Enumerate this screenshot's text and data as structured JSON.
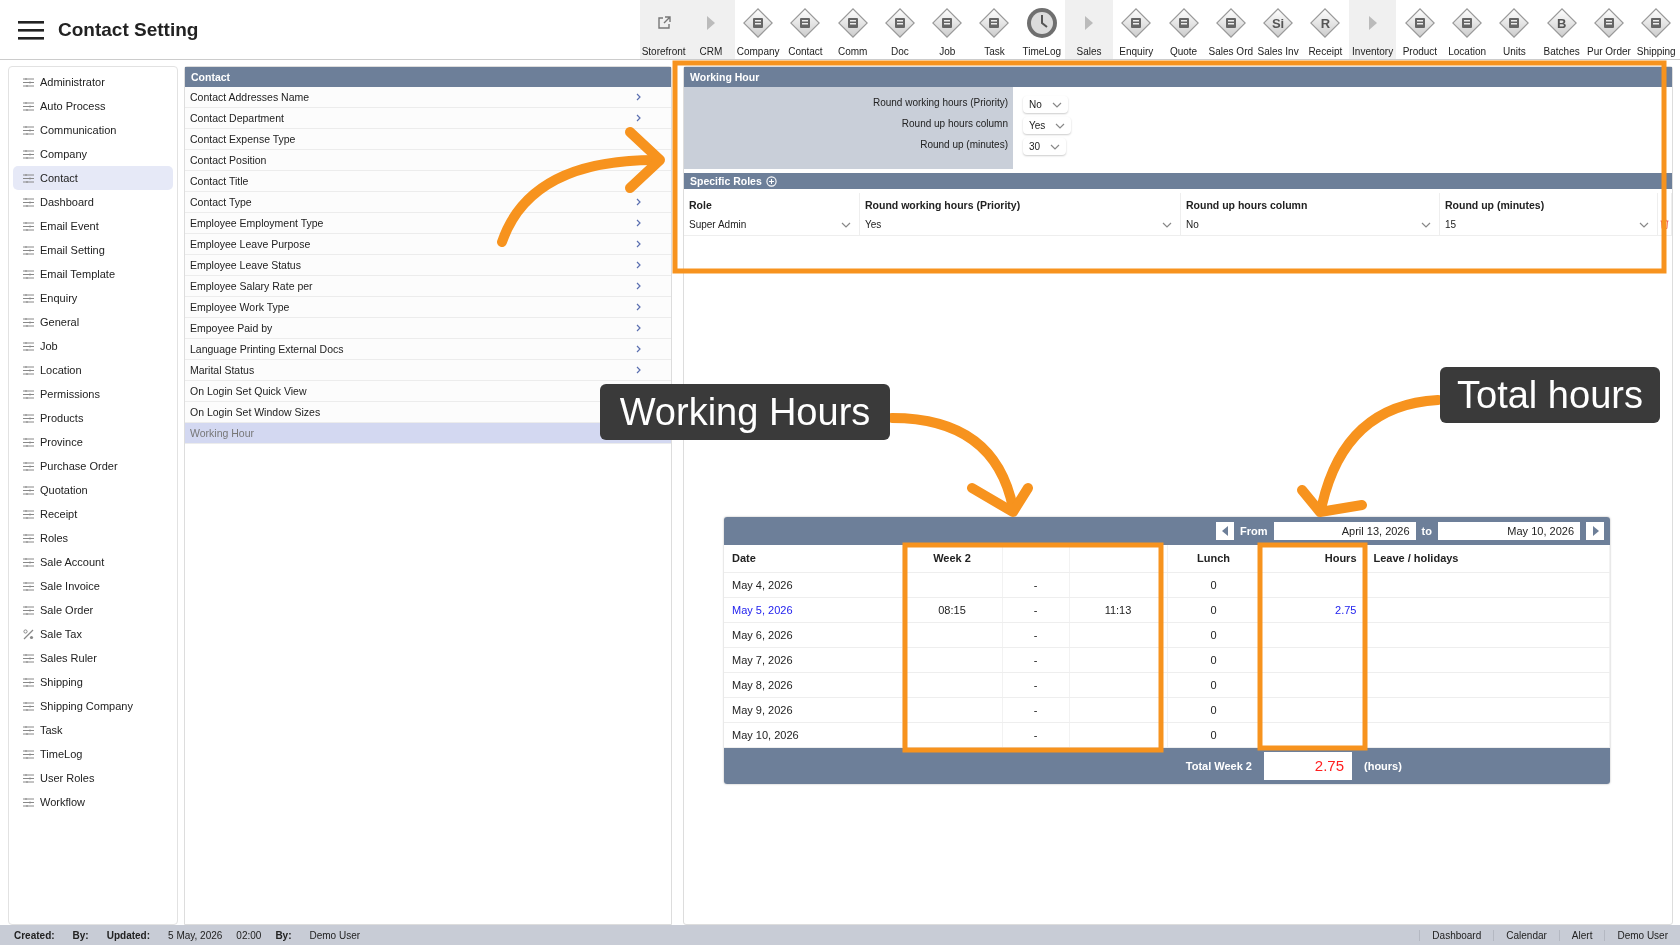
{
  "header": {
    "title": "Contact Setting"
  },
  "toolbar": [
    {
      "label": "Storefront",
      "kind": "link"
    },
    {
      "label": "CRM",
      "kind": "expander"
    },
    {
      "label": "Company",
      "kind": "module"
    },
    {
      "label": "Contact",
      "kind": "module"
    },
    {
      "label": "Comm",
      "kind": "module"
    },
    {
      "label": "Doc",
      "kind": "module"
    },
    {
      "label": "Job",
      "kind": "module"
    },
    {
      "label": "Task",
      "kind": "module"
    },
    {
      "label": "TimeLog",
      "kind": "clock"
    },
    {
      "label": "Sales",
      "kind": "expander"
    },
    {
      "label": "Enquiry",
      "kind": "module"
    },
    {
      "label": "Quote",
      "kind": "module"
    },
    {
      "label": "Sales Ord",
      "kind": "module"
    },
    {
      "label": "Sales Inv",
      "kind": "module",
      "glyph": "Si"
    },
    {
      "label": "Receipt",
      "kind": "module",
      "glyph": "R"
    },
    {
      "label": "Inventory",
      "kind": "expander"
    },
    {
      "label": "Product",
      "kind": "module"
    },
    {
      "label": "Location",
      "kind": "module"
    },
    {
      "label": "Units",
      "kind": "module"
    },
    {
      "label": "Batches",
      "kind": "module",
      "glyph": "B"
    },
    {
      "label": "Pur Order",
      "kind": "module"
    },
    {
      "label": "Shipping",
      "kind": "module"
    }
  ],
  "sidebar": {
    "items": [
      {
        "label": "Administrator",
        "kind": "list",
        "selected": false
      },
      {
        "label": "Auto Process",
        "kind": "list",
        "selected": false
      },
      {
        "label": "Communication",
        "kind": "list",
        "selected": false
      },
      {
        "label": "Company",
        "kind": "list",
        "selected": false
      },
      {
        "label": "Contact",
        "kind": "list",
        "selected": true
      },
      {
        "label": "Dashboard",
        "kind": "list",
        "selected": false
      },
      {
        "label": "Email Event",
        "kind": "list",
        "selected": false
      },
      {
        "label": "Email Setting",
        "kind": "list",
        "selected": false
      },
      {
        "label": "Email Template",
        "kind": "list",
        "selected": false
      },
      {
        "label": "Enquiry",
        "kind": "list",
        "selected": false
      },
      {
        "label": "General",
        "kind": "list",
        "selected": false
      },
      {
        "label": "Job",
        "kind": "list",
        "selected": false
      },
      {
        "label": "Location",
        "kind": "list",
        "selected": false
      },
      {
        "label": "Permissions",
        "kind": "list",
        "selected": false
      },
      {
        "label": "Products",
        "kind": "list",
        "selected": false
      },
      {
        "label": "Province",
        "kind": "list",
        "selected": false
      },
      {
        "label": "Purchase Order",
        "kind": "list",
        "selected": false
      },
      {
        "label": "Quotation",
        "kind": "list",
        "selected": false
      },
      {
        "label": "Receipt",
        "kind": "list",
        "selected": false
      },
      {
        "label": "Roles",
        "kind": "list",
        "selected": false
      },
      {
        "label": "Sale Account",
        "kind": "list",
        "selected": false
      },
      {
        "label": "Sale Invoice",
        "kind": "list",
        "selected": false
      },
      {
        "label": "Sale Order",
        "kind": "list",
        "selected": false
      },
      {
        "label": "Sale Tax",
        "kind": "percent",
        "selected": false
      },
      {
        "label": "Sales Ruler",
        "kind": "list",
        "selected": false
      },
      {
        "label": "Shipping",
        "kind": "list",
        "selected": false
      },
      {
        "label": "Shipping Company",
        "kind": "list",
        "selected": false
      },
      {
        "label": "Task",
        "kind": "list",
        "selected": false
      },
      {
        "label": "TimeLog",
        "kind": "list",
        "selected": false
      },
      {
        "label": "User Roles",
        "kind": "list",
        "selected": false
      },
      {
        "label": "Workflow",
        "kind": "list",
        "selected": false
      }
    ]
  },
  "settings_list": {
    "title": "Contact",
    "items": [
      {
        "label": "Contact Addresses Name",
        "selected": false
      },
      {
        "label": "Contact Department",
        "selected": false
      },
      {
        "label": "Contact Expense Type",
        "selected": false
      },
      {
        "label": "Contact Position",
        "selected": false
      },
      {
        "label": "Contact Title",
        "selected": false
      },
      {
        "label": "Contact Type",
        "selected": false
      },
      {
        "label": "Employee Employment Type",
        "selected": false
      },
      {
        "label": "Employee Leave Purpose",
        "selected": false
      },
      {
        "label": "Employee Leave Status",
        "selected": false
      },
      {
        "label": "Employee Salary Rate per",
        "selected": false
      },
      {
        "label": "Employee Work Type",
        "selected": false
      },
      {
        "label": "Empoyee Paid by",
        "selected": false
      },
      {
        "label": "Language Printing External Docs",
        "selected": false
      },
      {
        "label": "Marital Status",
        "selected": false
      },
      {
        "label": "On Login Set Quick View",
        "selected": false
      },
      {
        "label": "On Login Set Window Sizes",
        "selected": false
      },
      {
        "label": "Working Hour",
        "selected": true
      }
    ]
  },
  "working_hour": {
    "title": "Working Hour",
    "settings": [
      {
        "label": "Round working hours (Priority)",
        "value": "No"
      },
      {
        "label": "Round up hours column",
        "value": "Yes"
      },
      {
        "label": "Round up (minutes)",
        "value": "30"
      }
    ],
    "roles_title": "Specific Roles",
    "roles_columns": [
      "Role",
      "Round working hours (Priority)",
      "Round up hours column",
      "Round up (minutes)"
    ],
    "roles": [
      {
        "role": "Super Admin",
        "round_working_hours": "Yes",
        "round_up_hours_column": "No",
        "round_up_minutes": "15"
      }
    ]
  },
  "timesheet": {
    "from_label": "From",
    "from": "April 13, 2026",
    "to_label": "to",
    "to": "May 10, 2026",
    "columns": {
      "date": "Date",
      "week": "Week 2",
      "lunch": "Lunch",
      "hours": "Hours",
      "leave": "Leave / holidays"
    },
    "rows": [
      {
        "date": "May 4, 2026",
        "dash": "-",
        "lunch": "0",
        "highlighted": false
      },
      {
        "date": "May 5, 2026",
        "start": "08:15",
        "dash": "-",
        "end": "11:13",
        "lunch": "0",
        "hours": "2.75",
        "highlighted": true
      },
      {
        "date": "May 6, 2026",
        "dash": "-",
        "lunch": "0",
        "highlighted": false
      },
      {
        "date": "May 7, 2026",
        "dash": "-",
        "lunch": "0",
        "highlighted": false
      },
      {
        "date": "May 8, 2026",
        "dash": "-",
        "lunch": "0",
        "highlighted": false
      },
      {
        "date": "May 9, 2026",
        "dash": "-",
        "lunch": "0",
        "highlighted": false
      },
      {
        "date": "May 10, 2026",
        "dash": "-",
        "lunch": "0",
        "highlighted": false
      }
    ],
    "total_label": "Total Week 2",
    "total": "2.75",
    "total_unit": "(hours)"
  },
  "status_bar": {
    "fields": [
      {
        "label": "Created:"
      },
      {
        "label": "By:"
      },
      {
        "label": "Updated:",
        "value": "5 May, 2026"
      },
      {
        "value": "02:00"
      },
      {
        "label": "By:",
        "value": "Demo User"
      }
    ],
    "links": [
      "Dashboard",
      "Calendar",
      "Alert",
      "Demo User"
    ]
  },
  "annotations": [
    {
      "text": "Working Hours"
    },
    {
      "text": "Total hours"
    }
  ]
}
